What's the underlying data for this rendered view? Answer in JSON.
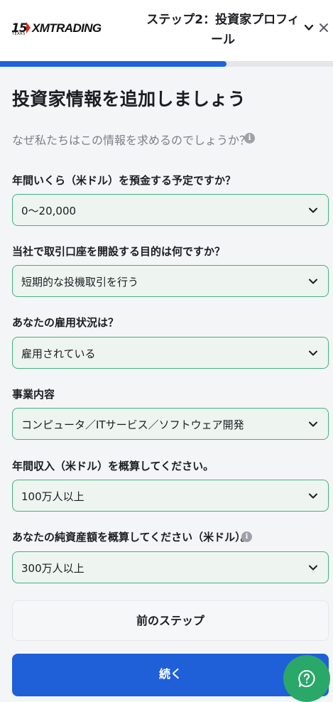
{
  "header": {
    "logo_number": "15",
    "logo_years": "YEARS",
    "logo_text": "XMTRADING",
    "step_title": "ステップ2：投資家プロフィール",
    "progress_percent": 68,
    "icons": [
      "chevron-down-icon",
      "close-icon"
    ]
  },
  "main": {
    "heading": "投資家情報を追加しましょう",
    "why_text": "なぜ私たちはこの情報を求めるのでしょうか？",
    "questions": [
      {
        "label": "年間いくら（米ドル）を預金する予定ですか？",
        "value": "0〜20,000"
      },
      {
        "label": "当社で取引口座を開設する目的は何ですか？",
        "value": "短期的な投機取引を行う"
      },
      {
        "label": "あなたの雇用状況は？",
        "value": "雇用されている"
      },
      {
        "label": "事業内容",
        "value": "コンピュータ／ITサービス／ソフトウェア開発"
      },
      {
        "label": "年間収入（米ドル）を概算してください。",
        "value": "100万人以上"
      },
      {
        "label": "あなたの純資産額を概算してください（米ドル）。",
        "value": "300万人以上"
      }
    ]
  },
  "buttons": {
    "prev_label": "前のステップ",
    "next_label": "続く"
  },
  "colors": {
    "accent": "#1f5fd8",
    "select_border": "#3fb27f",
    "select_bg": "#eef5f0",
    "chat": "#2aa86a"
  }
}
